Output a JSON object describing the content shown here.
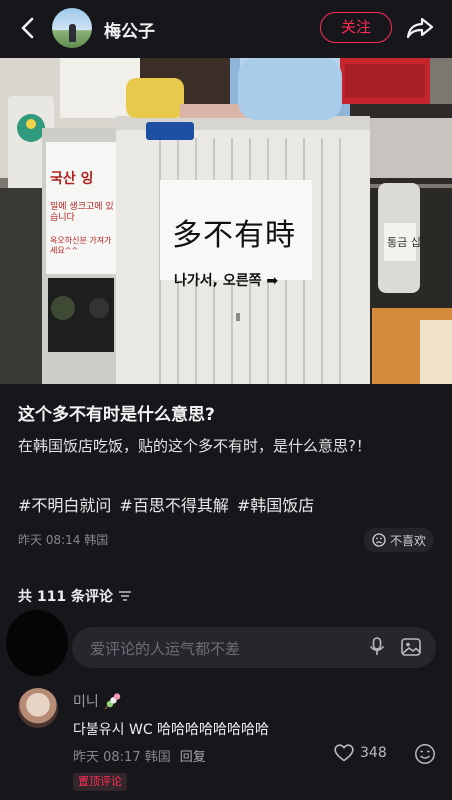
{
  "header": {
    "author_name": "梅公子",
    "follow_label": "关注",
    "back_icon": "chevron-left-icon",
    "share_icon": "share-arrow-icon"
  },
  "photo": {
    "sign_main": "多不有時",
    "sign_sub": "나가서, 오른쪽 ➡",
    "left_sign_lines": [
      "국산 잉",
      "밀에 생크고에 있습니다",
      "옥오하신분 가져가세요^^"
    ],
    "bottle_label": "통금 십"
  },
  "post": {
    "title": "这个多不有时是什么意思?",
    "body": "在韩国饭店吃饭，贴的这个多不有时，是什么意思?！",
    "tags": [
      "#不明白就问",
      "#百思不得其解",
      "#韩国饭店"
    ],
    "meta": "昨天 08:14 韩国",
    "dislike_label": "不喜欢"
  },
  "comments": {
    "count_label": "共 111 条评论",
    "input_placeholder": "爱评论的人运气都不差",
    "items": [
      {
        "user": "미니",
        "text": "다불유시 WC 哈哈哈哈哈哈哈哈",
        "time": "昨天 08:17 韩国",
        "reply_label": "回复",
        "likes": "348",
        "badge": "置顶评论"
      }
    ]
  },
  "colors": {
    "background": "#17171b",
    "accent": "#fe2c55",
    "muted": "#85858d"
  }
}
